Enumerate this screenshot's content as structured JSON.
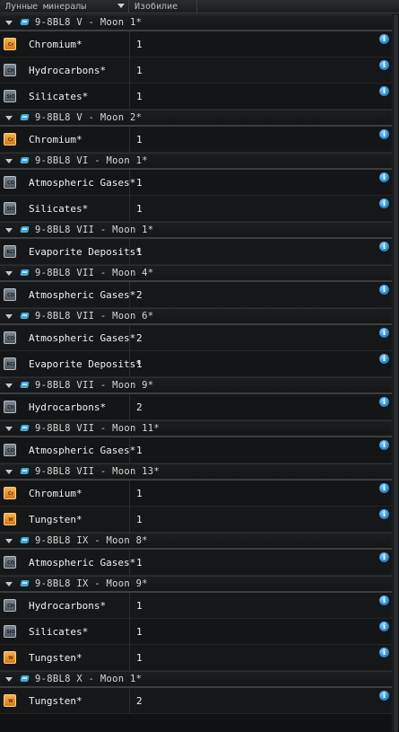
{
  "columns": {
    "col1": "Лунные минералы",
    "col2": "Изобилие"
  },
  "icons": {
    "sort": "sort-desc-icon",
    "expand": "caret-down-icon",
    "moon": "moon-icon",
    "info": "info-icon"
  },
  "colors": {
    "info_blue": "#2f8fd9",
    "moon_blue": "#3fa8e0",
    "chromium_orange": "#d4781b"
  },
  "groups": [
    {
      "label": "9-8BL8 V - Moon 1*",
      "items": [
        {
          "name": "Chromium*",
          "amount": "1",
          "icon": "Cr"
        },
        {
          "name": "Hydrocarbons*",
          "amount": "1",
          "icon": "CH"
        },
        {
          "name": "Silicates*",
          "amount": "1",
          "icon": "SiO"
        }
      ]
    },
    {
      "label": "9-8BL8 V - Moon 2*",
      "items": [
        {
          "name": "Chromium*",
          "amount": "1",
          "icon": "Cr"
        }
      ]
    },
    {
      "label": "9-8BL8 VI - Moon 1*",
      "items": [
        {
          "name": "Atmospheric Gases*",
          "amount": "1",
          "icon": "CO"
        },
        {
          "name": "Silicates*",
          "amount": "1",
          "icon": "SiO"
        }
      ]
    },
    {
      "label": "9-8BL8 VII - Moon 1*",
      "items": [
        {
          "name": "Evaporite Deposits*",
          "amount": "1",
          "icon": "KCl"
        }
      ]
    },
    {
      "label": "9-8BL8 VII - Moon 4*",
      "items": [
        {
          "name": "Atmospheric Gases*",
          "amount": "2",
          "icon": "CO"
        }
      ]
    },
    {
      "label": "9-8BL8 VII - Moon 6*",
      "items": [
        {
          "name": "Atmospheric Gases*",
          "amount": "2",
          "icon": "CO"
        },
        {
          "name": "Evaporite Deposits*",
          "amount": "1",
          "icon": "KCl"
        }
      ]
    },
    {
      "label": "9-8BL8 VII - Moon 9*",
      "items": [
        {
          "name": "Hydrocarbons*",
          "amount": "2",
          "icon": "CH"
        }
      ]
    },
    {
      "label": "9-8BL8 VII - Moon 11*",
      "items": [
        {
          "name": "Atmospheric Gases*",
          "amount": "1",
          "icon": "CO"
        }
      ]
    },
    {
      "label": "9-8BL8 VII - Moon 13*",
      "items": [
        {
          "name": "Chromium*",
          "amount": "1",
          "icon": "Cr"
        },
        {
          "name": "Tungsten*",
          "amount": "1",
          "icon": "W"
        }
      ]
    },
    {
      "label": "9-8BL8 IX - Moon 8*",
      "items": [
        {
          "name": "Atmospheric Gases*",
          "amount": "1",
          "icon": "CO"
        }
      ]
    },
    {
      "label": "9-8BL8 IX - Moon 9*",
      "items": [
        {
          "name": "Hydrocarbons*",
          "amount": "1",
          "icon": "CH"
        },
        {
          "name": "Silicates*",
          "amount": "1",
          "icon": "SiO"
        },
        {
          "name": "Tungsten*",
          "amount": "1",
          "icon": "W"
        }
      ]
    },
    {
      "label": "9-8BL8 X - Moon 1*",
      "items": [
        {
          "name": "Tungsten*",
          "amount": "2",
          "icon": "W"
        }
      ]
    }
  ]
}
